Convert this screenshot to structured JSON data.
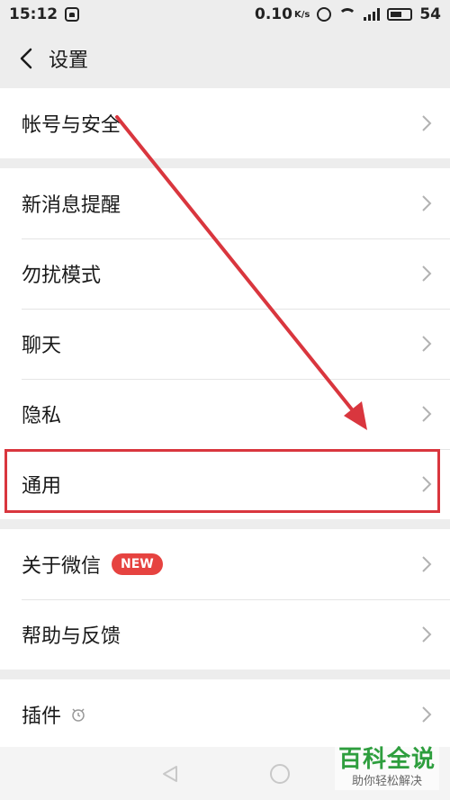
{
  "status_bar": {
    "time": "15:12",
    "speed": "0.10",
    "speed_unit": "K/s",
    "battery": "54"
  },
  "header": {
    "title": "设置"
  },
  "groups": [
    {
      "items": [
        {
          "label": "帐号与安全"
        }
      ]
    },
    {
      "items": [
        {
          "label": "新消息提醒"
        },
        {
          "label": "勿扰模式"
        },
        {
          "label": "聊天"
        },
        {
          "label": "隐私"
        },
        {
          "label": "通用"
        }
      ]
    },
    {
      "items": [
        {
          "label": "关于微信",
          "badge": "NEW"
        },
        {
          "label": "帮助与反馈"
        }
      ]
    },
    {
      "items": [
        {
          "label": "插件"
        }
      ]
    }
  ],
  "watermark": {
    "title": "百科全说",
    "subtitle": "助你轻松解决"
  },
  "colors": {
    "accent_red": "#d9363e",
    "badge_red": "#e64340",
    "watermark_green": "#2e9e3e"
  }
}
